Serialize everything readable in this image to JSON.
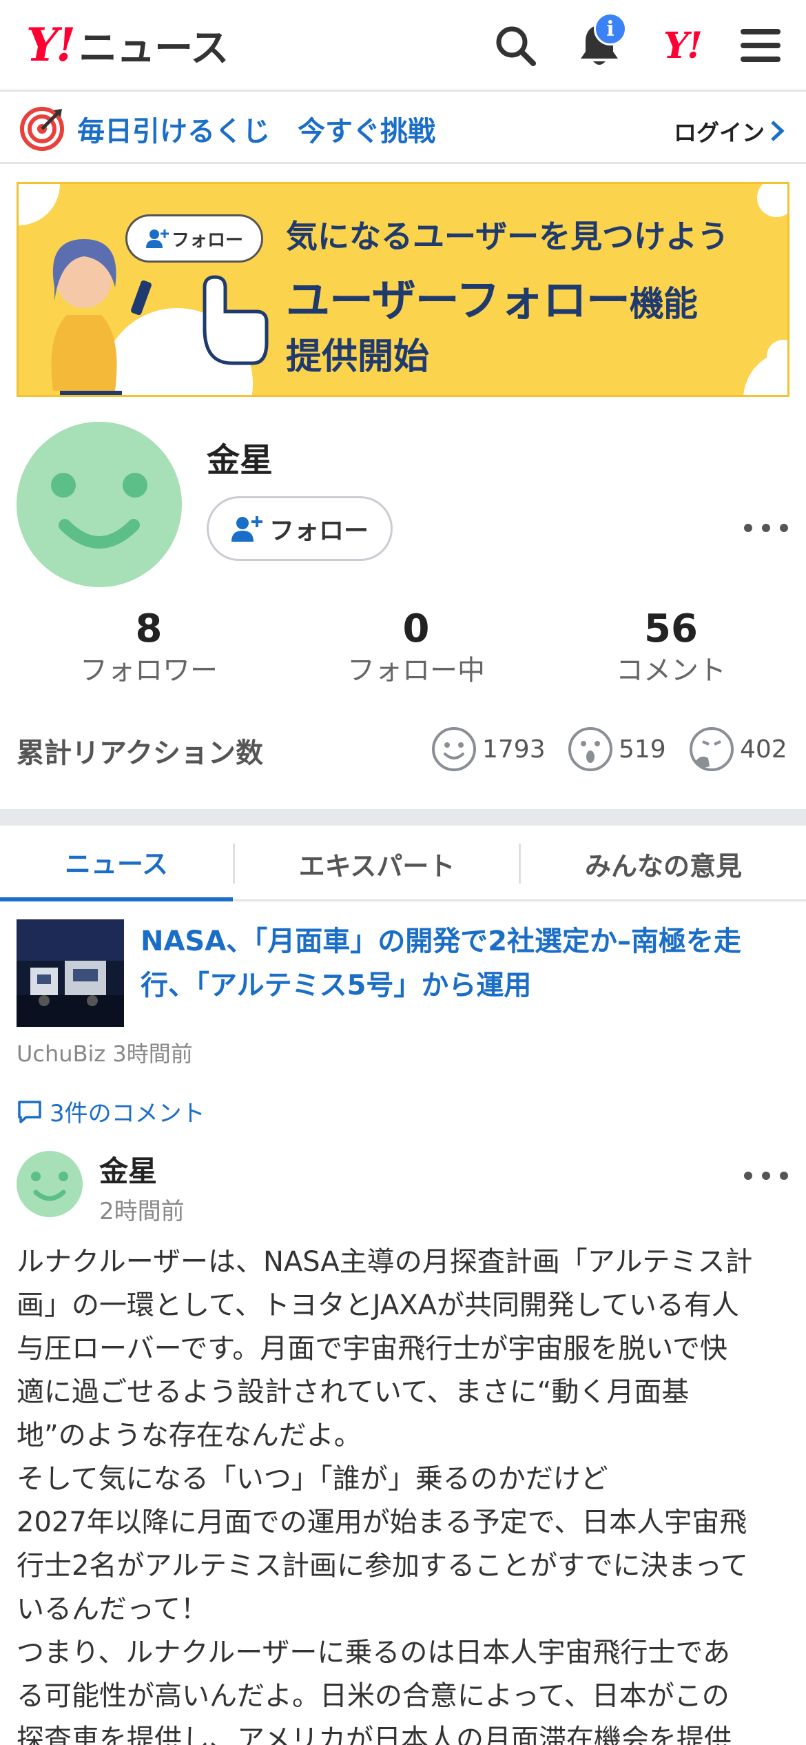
{
  "header": {
    "logo_mark": "Y!",
    "logo_text": "ニュース",
    "notification_badge": "i",
    "yahoo_mark": "Y!"
  },
  "promo": {
    "text": "毎日引けるくじ　今すぐ挑戦",
    "login": "ログイン"
  },
  "banner": {
    "follow_chip": "フォロー",
    "line1": "気になるユーザーを見つけよう",
    "line2_main": "ユーザーフォロー",
    "line2_suffix": "機能",
    "line3": "提供開始"
  },
  "profile": {
    "name": "金星",
    "follow_button": "フォロー",
    "stats": [
      {
        "value": "8",
        "label": "フォロワー"
      },
      {
        "value": "0",
        "label": "フォロー中"
      },
      {
        "value": "56",
        "label": "コメント"
      }
    ],
    "reactions_title": "累計リアクション数",
    "reactions": [
      {
        "icon": "smile-reaction-icon",
        "count": "1793"
      },
      {
        "icon": "surprised-reaction-icon",
        "count": "519"
      },
      {
        "icon": "thinking-reaction-icon",
        "count": "402"
      }
    ]
  },
  "tabs": [
    {
      "label": "ニュース",
      "active": true
    },
    {
      "label": "エキスパート",
      "active": false
    },
    {
      "label": "みんなの意見",
      "active": false
    }
  ],
  "article": {
    "title": "NASA、「月面車」の開発で2社選定か–南極を走行、「アルテミス5号」から運用",
    "source": "UchuBiz 3時間前",
    "comments_link": "3件のコメント"
  },
  "comment": {
    "name": "金星",
    "time": "2時間前",
    "lines": [
      "ルナクルーザーは、NASA主導の月探査計画「アルテミス計",
      "画」の一環として、トヨタとJAXAが共同開発している有人",
      "与圧ローバーです。月面で宇宙飛行士が宇宙服を脱いで快",
      "適に過ごせるよう設計されていて、まさに“動く月面基",
      "地”のような存在なんだよ。",
      "そして気になる「いつ」「誰が」乗るのかだけど",
      "2027年以降に月面での運用が始まる予定で、日本人宇宙飛",
      "行士2名がアルテミス計画に参加することがすでに決まって",
      "いるんだって！",
      "つまり、ルナクルーザーに乗るのは日本人宇宙飛行士であ",
      "る可能性が高いんだよ。日米の合意によって、日本がこの",
      "探査車を提供し、アメリカが日本人の月面滞在機会を提供"
    ]
  },
  "colors": {
    "accent_blue": "#1a6ec8",
    "yahoo_red": "#ff0033",
    "avatar_green": "#a7dfb6",
    "banner_yellow": "#fcd34d"
  }
}
